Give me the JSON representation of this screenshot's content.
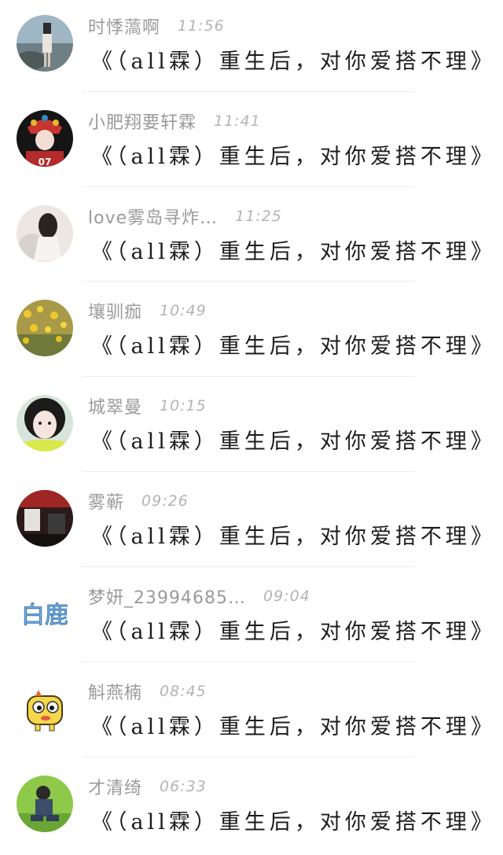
{
  "comments": [
    {
      "name": "时悸薃啊",
      "time": "11:56",
      "message": "《（all霖）重生后，对你爱搭不理》",
      "avatar_icon": "girl-by-sea-avatar-icon"
    },
    {
      "name": "小肥翔要轩霖",
      "time": "11:41",
      "message": "《（all霖）重生后，对你爱搭不理》",
      "avatar_icon": "opera-headdress-avatar-icon"
    },
    {
      "name": "love雾岛寻炸…",
      "time": "11:25",
      "message": "《（all霖）重生后，对你爱搭不理》",
      "avatar_icon": "girl-white-dress-avatar-icon"
    },
    {
      "name": "壤驯痂",
      "time": "10:49",
      "message": "《（all霖）重生后，对你爱搭不理》",
      "avatar_icon": "yellow-flowers-avatar-icon"
    },
    {
      "name": "城翠曼",
      "time": "10:15",
      "message": "《（all霖）重生后，对你爱搭不理》",
      "avatar_icon": "girl-face-avatar-icon"
    },
    {
      "name": "雾蕲",
      "time": "09:26",
      "message": "《（all霖）重生后，对你爱搭不理》",
      "avatar_icon": "dark-room-avatar-icon"
    },
    {
      "name": "梦妍_23994685…",
      "time": "09:04",
      "message": "《（all霖）重生后，对你爱搭不理》",
      "avatar_icon": "bailu-text-avatar-icon",
      "avatar_text": "白鹿"
    },
    {
      "name": "斛燕楠",
      "time": "08:45",
      "message": "《（all霖）重生后，对你爱搭不理》",
      "avatar_icon": "cartoon-yellow-monster-avatar-icon"
    },
    {
      "name": "才清绮",
      "time": "06:33",
      "message": "《（all霖）重生后，对你爱搭不理》",
      "avatar_icon": "boy-on-grass-avatar-icon"
    }
  ]
}
